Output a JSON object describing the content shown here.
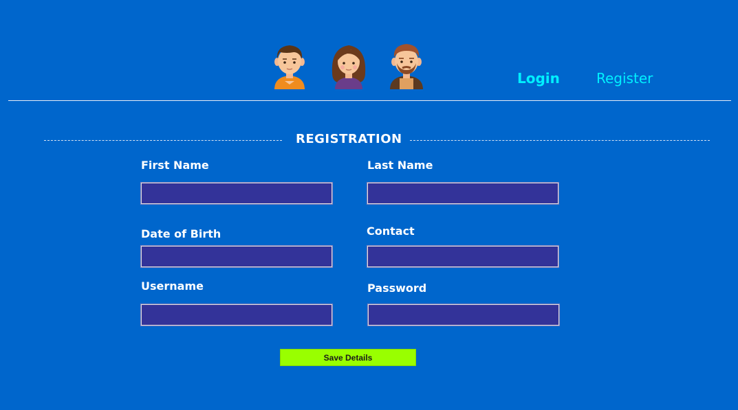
{
  "header": {
    "avatars": [
      "boy-avatar-icon",
      "girl-avatar-icon",
      "bearded-man-avatar-icon"
    ],
    "nav": {
      "login_label": "Login",
      "register_label": "Register"
    }
  },
  "form": {
    "title": "REGISTRATION",
    "fields": {
      "first_name": {
        "label": "First Name",
        "value": ""
      },
      "last_name": {
        "label": "Last Name",
        "value": ""
      },
      "date_of_birth": {
        "label": "Date of Birth",
        "value": ""
      },
      "contact": {
        "label": "Contact",
        "value": ""
      },
      "username": {
        "label": "Username",
        "value": ""
      },
      "password": {
        "label": "Password",
        "value": ""
      }
    },
    "submit_label": "Save Details"
  },
  "colors": {
    "background": "#0066cc",
    "nav_link": "#00f0ff",
    "input_fill": "#333399",
    "submit_button": "#99ff00"
  }
}
